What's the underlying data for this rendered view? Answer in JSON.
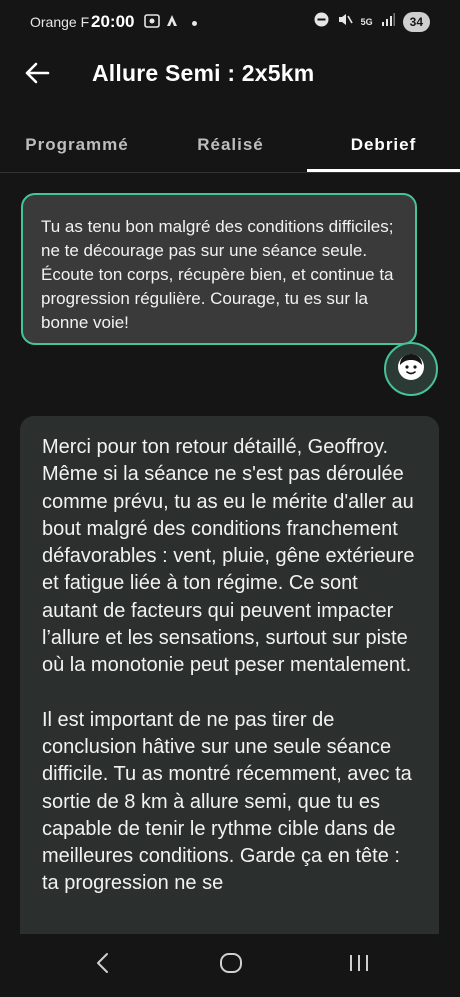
{
  "status_bar": {
    "carrier": "Orange F",
    "time": "20:00",
    "network": "5G",
    "battery": "34"
  },
  "header": {
    "title": "Allure Semi : 2x5km",
    "back_icon": "arrow-left-icon"
  },
  "tabs": [
    {
      "label": "Programmé",
      "active": false
    },
    {
      "label": "Réalisé",
      "active": false
    },
    {
      "label": "Debrief",
      "active": true
    }
  ],
  "coach_message": {
    "text": "Tu as tenu bon malgré des conditions difficiles; ne te décourage pas sur une séance seule. Écoute ton corps, récupère bien, et continue ta progression régulière. Courage, tu es sur la bonne voie!",
    "avatar_icon": "coach-face-icon"
  },
  "user_message": {
    "paragraphs": [
      "Merci pour ton retour détaillé, Geoffroy. Même si la séance ne s'est pas déroulée comme prévu, tu as eu le mérite d'aller au bout malgré des conditions franchement défavorables : vent, pluie, gêne extérieure et fatigue liée à ton régime. Ce sont autant de facteurs qui peuvent impacter l’allure et les sensations, surtout sur piste où la monotonie peut peser mentalement.",
      "Il est important de ne pas tirer de conclusion hâtive sur une seule séance difficile. Tu as montré récemment, avec ta sortie de 8 km à allure semi, que tu es capable de tenir le rythme cible dans de meilleures conditions. Garde ça en tête : ta progression ne se"
    ]
  },
  "nav_bar": {
    "back_icon": "nav-back-icon",
    "home_icon": "nav-home-icon",
    "recents_icon": "nav-recents-icon"
  },
  "colors": {
    "background": "#151515",
    "accent": "#47c497",
    "coach_bubble": "#3a3a3a",
    "message_card": "#2b302e"
  }
}
